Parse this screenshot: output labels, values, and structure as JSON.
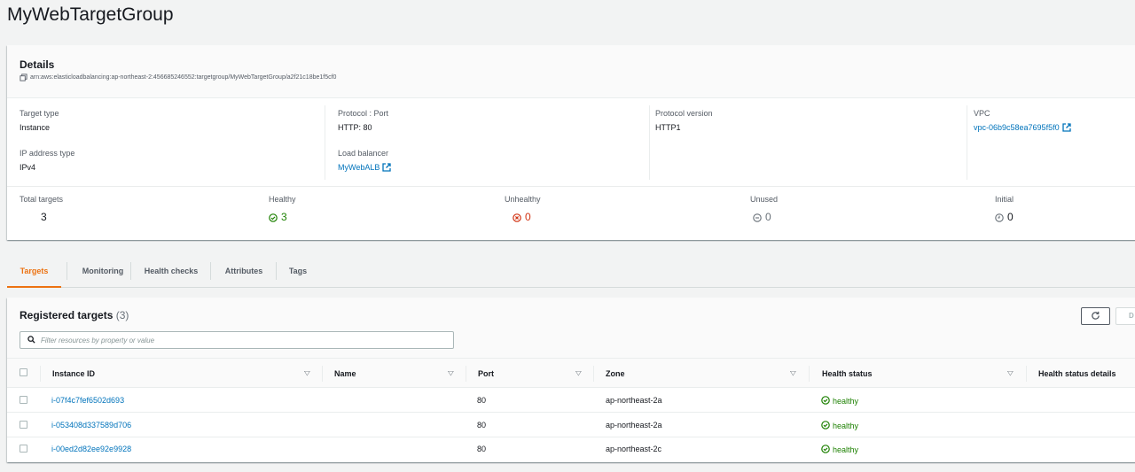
{
  "page": {
    "title": "MyWebTargetGroup"
  },
  "details": {
    "title": "Details",
    "arn": "arn:aws:elasticloadbalancing:ap-northeast-2:456685246552:targetgroup/MyWebTargetGroup/a2f21c18be1f5cf0",
    "target_type": {
      "label": "Target type",
      "value": "Instance"
    },
    "protocol_port": {
      "label": "Protocol : Port",
      "value": "HTTP: 80"
    },
    "protocol_version": {
      "label": "Protocol version",
      "value": "HTTP1"
    },
    "vpc": {
      "label": "VPC",
      "value": "vpc-06b9c58ea7695f5f0"
    },
    "ip_address_type": {
      "label": "IP address type",
      "value": "IPv4"
    },
    "load_balancer": {
      "label": "Load balancer",
      "value": "MyWebALB"
    },
    "stats": {
      "total": {
        "label": "Total targets",
        "value": "3"
      },
      "healthy": {
        "label": "Healthy",
        "value": "3",
        "color": "#1d8102"
      },
      "unhealthy": {
        "label": "Unhealthy",
        "value": "0",
        "color": "#d13212"
      },
      "unused": {
        "label": "Unused",
        "value": "0",
        "color": "#687078"
      },
      "initial": {
        "label": "Initial",
        "value": "0",
        "color": "#16191f"
      }
    }
  },
  "tabs": [
    {
      "label": "Targets",
      "active": true
    },
    {
      "label": "Monitoring",
      "active": false
    },
    {
      "label": "Health checks",
      "active": false
    },
    {
      "label": "Attributes",
      "active": false
    },
    {
      "label": "Tags",
      "active": false
    }
  ],
  "targets": {
    "title": "Registered targets",
    "count": "(3)",
    "d_button_label": "D",
    "search_placeholder": "Filter resources by property or value",
    "columns": {
      "instance_id": "Instance ID",
      "name": "Name",
      "port": "Port",
      "zone": "Zone",
      "health_status": "Health status",
      "health_status_details": "Health status details"
    },
    "rows": [
      {
        "instance_id": "i-07f4c7fef6502d693",
        "name": "",
        "port": "80",
        "zone": "ap-northeast-2a",
        "health": "healthy"
      },
      {
        "instance_id": "i-053408d337589d706",
        "name": "",
        "port": "80",
        "zone": "ap-northeast-2a",
        "health": "healthy"
      },
      {
        "instance_id": "i-00ed2d82ee92e9928",
        "name": "",
        "port": "80",
        "zone": "ap-northeast-2c",
        "health": "healthy"
      }
    ]
  },
  "colors": {
    "link": "#0073bb",
    "accent": "#ec7211",
    "healthy": "#1d8102",
    "unhealthy": "#d13212"
  },
  "icons": [
    "copy-icon",
    "external-link-icon",
    "check-circle-icon",
    "x-circle-icon",
    "minus-circle-icon",
    "clock-icon",
    "refresh-icon",
    "search-icon",
    "sort-down-icon"
  ]
}
